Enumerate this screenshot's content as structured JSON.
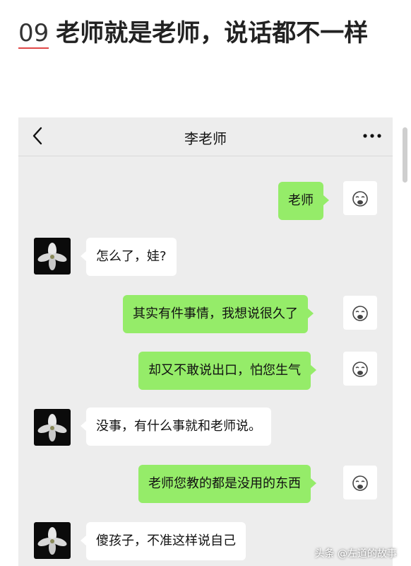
{
  "article": {
    "number": "09",
    "title": "老师就是老师，说话都不一样"
  },
  "chat": {
    "title": "李老师",
    "messages": [
      {
        "side": "me",
        "text": "老师"
      },
      {
        "side": "them",
        "text": "怎么了，娃?"
      },
      {
        "side": "me",
        "text": "其实有件事情，我想说很久了"
      },
      {
        "side": "me",
        "text": "却又不敢说出口，怕您生气"
      },
      {
        "side": "them",
        "text": "没事，有什么事就和老师说。"
      },
      {
        "side": "me",
        "text": "老师您教的都是没用的东西"
      },
      {
        "side": "them",
        "text": "傻孩子，不准这样说自己"
      }
    ]
  },
  "watermark": "头条 @左道的故事",
  "colors": {
    "my_bubble": "#95ec69",
    "their_bubble": "#ffffff",
    "chat_background": "#ededed",
    "number_underline": "#e04848"
  },
  "icons": {
    "back": "chevron-left-icon",
    "more": "more-dots-icon",
    "my_avatar": "crying-face-sticker-icon",
    "teacher_avatar": "white-flower-photo-icon"
  }
}
